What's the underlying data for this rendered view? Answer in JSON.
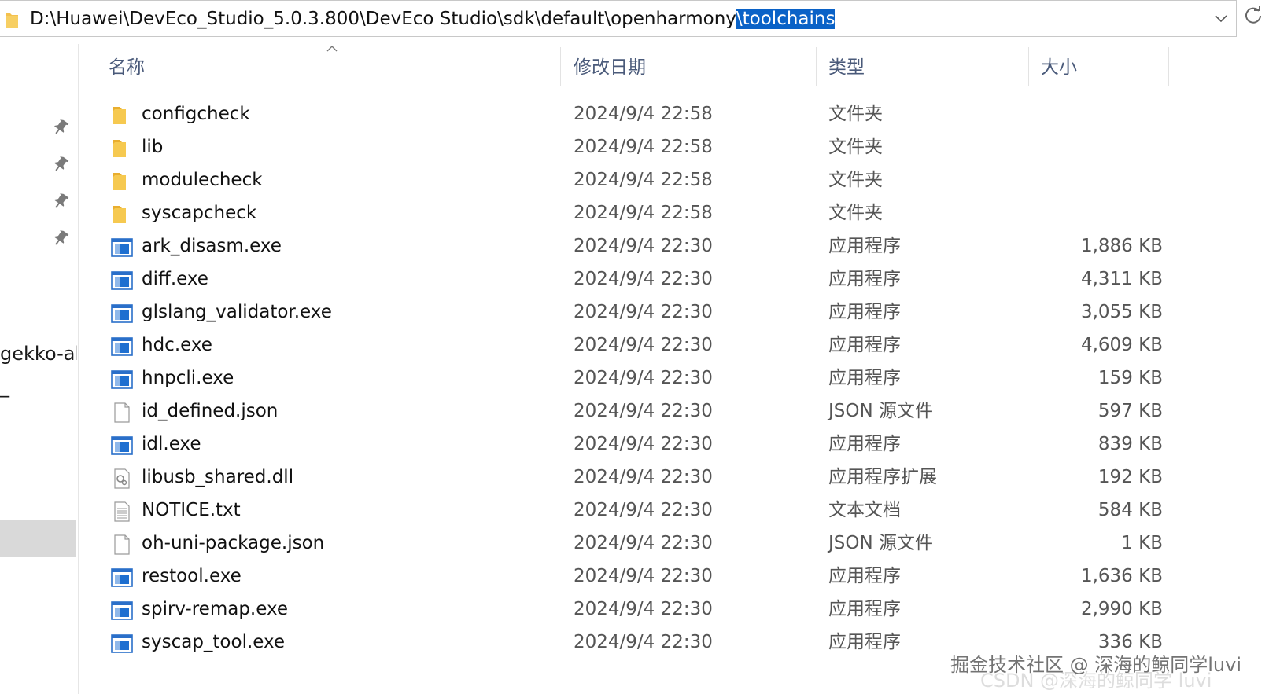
{
  "address_bar": {
    "path_prefix": "D:\\Huawei\\DevEco_Studio_5.0.3.800\\DevEco Studio\\sdk\\default\\openharmony",
    "path_selected": "\\toolchains",
    "dropdown_icon": "chevron-down-icon",
    "refresh_icon": "refresh-icon"
  },
  "nav": {
    "pins": [
      "pin-icon",
      "pin-icon",
      "pin-icon",
      "pin-icon"
    ],
    "truncated_item": "gekko-all-",
    "truncated_item2": "_"
  },
  "columns": {
    "name": "名称",
    "date": "修改日期",
    "type": "类型",
    "size": "大小"
  },
  "files": [
    {
      "name": "configcheck",
      "date": "2024/9/4 22:58",
      "type": "文件夹",
      "size": "",
      "icon": "folder"
    },
    {
      "name": "lib",
      "date": "2024/9/4 22:58",
      "type": "文件夹",
      "size": "",
      "icon": "folder"
    },
    {
      "name": "modulecheck",
      "date": "2024/9/4 22:58",
      "type": "文件夹",
      "size": "",
      "icon": "folder"
    },
    {
      "name": "syscapcheck",
      "date": "2024/9/4 22:58",
      "type": "文件夹",
      "size": "",
      "icon": "folder"
    },
    {
      "name": "ark_disasm.exe",
      "date": "2024/9/4 22:30",
      "type": "应用程序",
      "size": "1,886 KB",
      "icon": "exe"
    },
    {
      "name": "diff.exe",
      "date": "2024/9/4 22:30",
      "type": "应用程序",
      "size": "4,311 KB",
      "icon": "exe"
    },
    {
      "name": "glslang_validator.exe",
      "date": "2024/9/4 22:30",
      "type": "应用程序",
      "size": "3,055 KB",
      "icon": "exe"
    },
    {
      "name": "hdc.exe",
      "date": "2024/9/4 22:30",
      "type": "应用程序",
      "size": "4,609 KB",
      "icon": "exe"
    },
    {
      "name": "hnpcli.exe",
      "date": "2024/9/4 22:30",
      "type": "应用程序",
      "size": "159 KB",
      "icon": "exe"
    },
    {
      "name": "id_defined.json",
      "date": "2024/9/4 22:30",
      "type": "JSON 源文件",
      "size": "597 KB",
      "icon": "file"
    },
    {
      "name": "idl.exe",
      "date": "2024/9/4 22:30",
      "type": "应用程序",
      "size": "839 KB",
      "icon": "exe"
    },
    {
      "name": "libusb_shared.dll",
      "date": "2024/9/4 22:30",
      "type": "应用程序扩展",
      "size": "192 KB",
      "icon": "dll"
    },
    {
      "name": "NOTICE.txt",
      "date": "2024/9/4 22:30",
      "type": "文本文档",
      "size": "584 KB",
      "icon": "txt"
    },
    {
      "name": "oh-uni-package.json",
      "date": "2024/9/4 22:30",
      "type": "JSON 源文件",
      "size": "1 KB",
      "icon": "file"
    },
    {
      "name": "restool.exe",
      "date": "2024/9/4 22:30",
      "type": "应用程序",
      "size": "1,636 KB",
      "icon": "exe"
    },
    {
      "name": "spirv-remap.exe",
      "date": "2024/9/4 22:30",
      "type": "应用程序",
      "size": "2,990 KB",
      "icon": "exe"
    },
    {
      "name": "syscap_tool.exe",
      "date": "2024/9/4 22:30",
      "type": "应用程序",
      "size": "336 KB",
      "icon": "exe"
    }
  ],
  "watermark": {
    "text": "掘金技术社区 @ 深海的鲸同学luvi",
    "ghost": "CSDN @深海的鲸同学 luvi"
  },
  "colors": {
    "selection": "#0a62c7",
    "folder": "#f4c14e",
    "exe_blue": "#1e6fd0",
    "header_text": "#4a5a7a"
  }
}
